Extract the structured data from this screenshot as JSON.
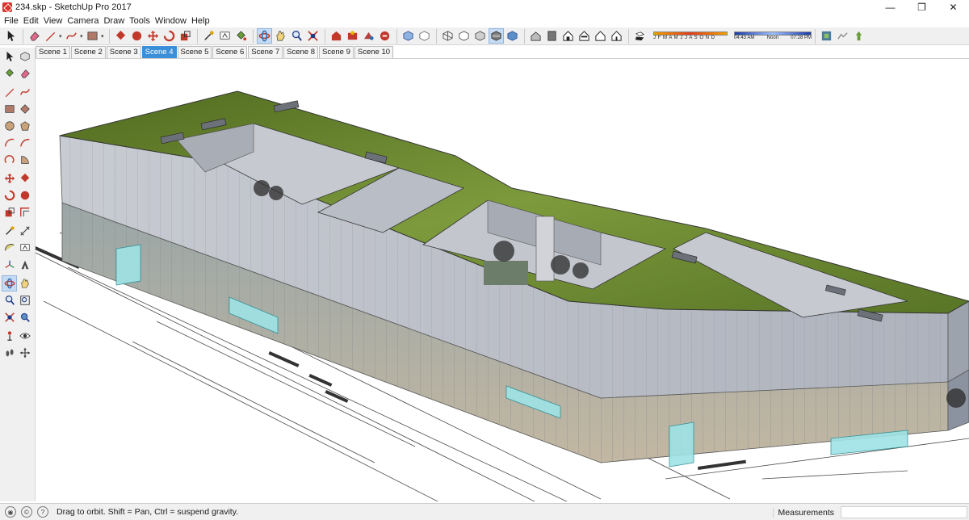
{
  "window": {
    "title": "234.skp - SketchUp Pro 2017",
    "minimize_glyph": "—",
    "maximize_glyph": "❐",
    "close_glyph": "✕"
  },
  "menu": [
    "File",
    "Edit",
    "View",
    "Camera",
    "Draw",
    "Tools",
    "Window",
    "Help"
  ],
  "shadow_widget": {
    "month_letters": "J F M A M J J A S O N D",
    "time_start": "04:43 AM",
    "time_mid": "Noon",
    "time_end": "07:28 PM"
  },
  "scenes": [
    "Scene 1",
    "Scene 2",
    "Scene 3",
    "Scene 4",
    "Scene 5",
    "Scene 6",
    "Scene 7",
    "Scene 8",
    "Scene 9",
    "Scene 10"
  ],
  "active_scene_index": 3,
  "status": {
    "hint": "Drag to orbit. Shift = Pan, Ctrl = suspend gravity.",
    "measurements_label": "Measurements",
    "measurements_value": ""
  },
  "colors": {
    "roof_green": "#5e7a2a",
    "roof_green_light": "#8aa04a",
    "concrete": "#c9cbd0",
    "glass": "#9fe3e6",
    "facade": "#b8b0a0",
    "accent_blue": "#3b8fd8"
  }
}
